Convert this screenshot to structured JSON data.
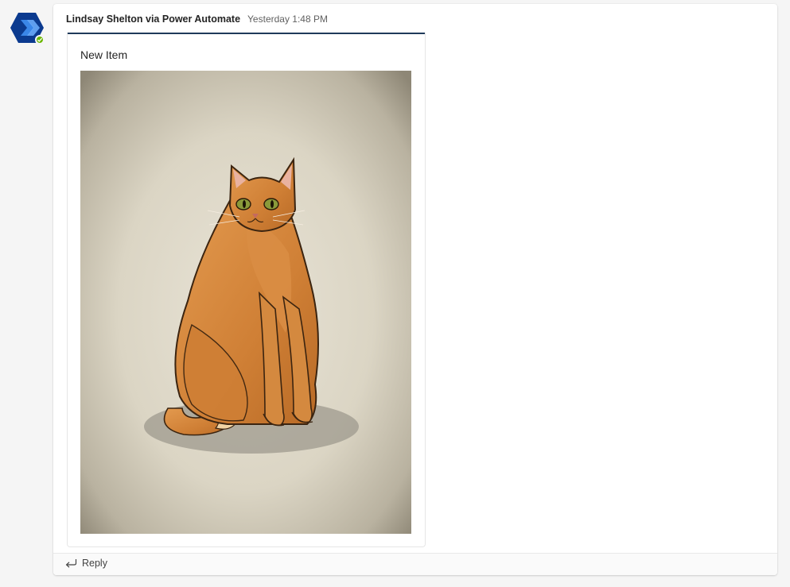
{
  "message": {
    "sender": "Lindsay Shelton via Power Automate",
    "timestamp": "Yesterday 1:48 PM",
    "avatar_icon": "power-automate-icon",
    "presence": "available",
    "presence_color": "#6bb700"
  },
  "card": {
    "title": "New Item",
    "accent_color": "#1f3a5a",
    "image_subject": "illustration of an orange tabby cat"
  },
  "reply": {
    "label": "Reply",
    "icon": "reply-arrow-icon"
  }
}
